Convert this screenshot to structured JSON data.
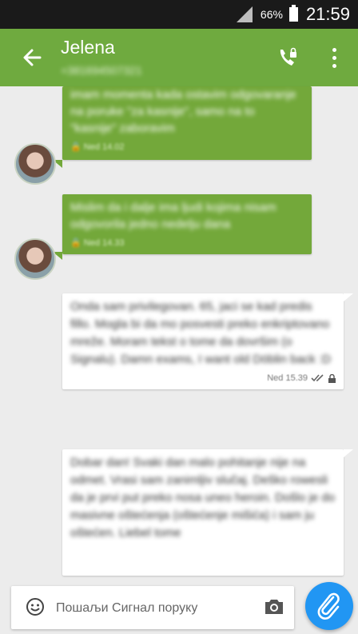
{
  "status_bar": {
    "battery_text": "66%",
    "time": "21:59"
  },
  "app_bar": {
    "contact_name": "Jelena",
    "contact_number": "+381694507321"
  },
  "messages": [
    {
      "direction": "outgoing",
      "text": "imam momenta kada ostavim odgovaranje na poruke \"za kasnije\", samo na to \"kasnije\" zaboravim",
      "time": "Ned 14.02"
    },
    {
      "direction": "outgoing",
      "text": "Mislim da i dalje ima ljudi kojima nisam odgovorila jedno nedelju dana",
      "time": "Ned 14.33"
    },
    {
      "direction": "incoming",
      "text": "Onda sam privilegovan. 65, jaci se kad predis fillo. Mogla bi da mo posvesti preko enkriptovano mreže. Moram tekst o tome da dovršim (o Signalu). Damn exams, I want old Döblin back :D",
      "time": "Ned 15.39"
    },
    {
      "direction": "incoming",
      "text": "Dobar dan! Svaki dan malo pohitanje nije na odmet. Vrasi sam zanimljiv slučaj. Deško rowesli da je prvi put preko nosa uneo heroin. Došlo je do masivne oštećenja (oštećenje mišića) i sam ju oštećen. Liebel tome"
    }
  ],
  "composer": {
    "placeholder": "Пошаљи Сигнал поруку"
  },
  "colors": {
    "app_bar": "#6faa3f",
    "outgoing_bubble": "#73a83a",
    "incoming_bubble": "#ffffff",
    "attach_button": "#2196f3",
    "background": "#ececec"
  },
  "icons": [
    "signal-icon",
    "battery-icon",
    "back-arrow-icon",
    "phone-lock-icon",
    "more-vert-icon",
    "lock-icon",
    "double-check-icon",
    "emoji-icon",
    "camera-icon",
    "paperclip-icon"
  ]
}
